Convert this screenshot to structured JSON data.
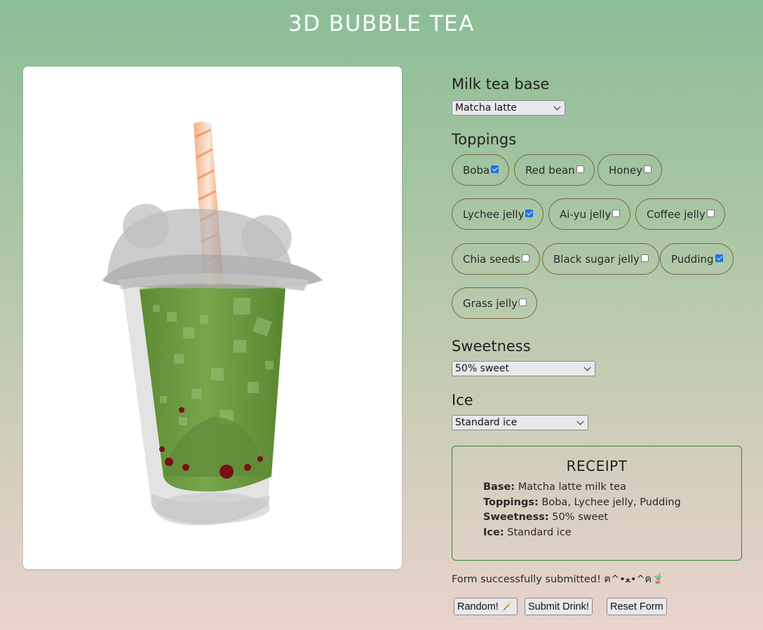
{
  "header": {
    "title": "3D BUBBLE TEA"
  },
  "form": {
    "base": {
      "heading": "Milk tea base",
      "selected": "Matcha latte"
    },
    "toppings": {
      "heading": "Toppings",
      "items": [
        {
          "label": "Boba",
          "checked": true
        },
        {
          "label": "Red bean",
          "checked": false
        },
        {
          "label": "Honey",
          "checked": false
        },
        {
          "label": "Lychee jelly",
          "checked": true
        },
        {
          "label": "Ai-yu jelly",
          "checked": false
        },
        {
          "label": "Coffee jelly",
          "checked": false
        },
        {
          "label": "Chia seeds",
          "checked": false
        },
        {
          "label": "Black sugar jelly",
          "checked": false
        },
        {
          "label": "Pudding",
          "checked": true
        },
        {
          "label": "Grass jelly",
          "checked": false
        }
      ]
    },
    "sweetness": {
      "heading": "Sweetness",
      "selected": "50% sweet"
    },
    "ice": {
      "heading": "Ice",
      "selected": "Standard ice"
    }
  },
  "receipt": {
    "title": "RECEIPT",
    "base_label": "Base:",
    "base_value": "Matcha latte milk tea",
    "toppings_label": "Toppings:",
    "toppings_value": "Boba, Lychee jelly, Pudding",
    "sweetness_label": "Sweetness:",
    "sweetness_value": "50% sweet",
    "ice_label": "Ice:",
    "ice_value": "Standard ice"
  },
  "status": {
    "message": "Form successfully submitted! ฅ^•ﻌ•^ฅ🧋"
  },
  "buttons": {
    "random": "Random! 🪄",
    "submit": "Submit Drink!",
    "reset": "Reset Form"
  },
  "colors": {
    "matcha": "#6e9a3f",
    "boba": "#7a0f16",
    "straw": "#f0a070",
    "receipt_border": "#2e8b2e",
    "pill_border": "#7d6b3e"
  }
}
